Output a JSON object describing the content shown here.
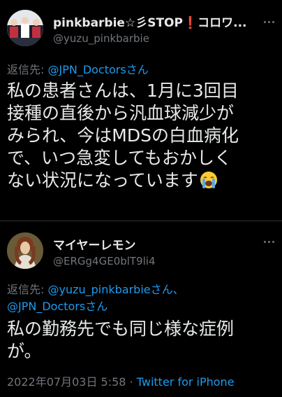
{
  "tweet1": {
    "author_name": "pinkbarbie☆彡STOP❗️コロワ...",
    "author_handle": "@yuzu_pinkbarbie",
    "reply_prefix": "返信先: ",
    "reply_mention": "@JPN_Doctors",
    "reply_suffix": "さん",
    "body_lines": [
      "私の患者さんは、1月に3回目",
      "接種の直後から汎血球減少が",
      "みられ、今はMDSの白血病化",
      "で、いつ急変してもおかしく",
      "ない状況になっています"
    ],
    "emoji_icon": "loudly-crying-face-icon"
  },
  "tweet2": {
    "author_name": "マイヤーレモン",
    "author_handle": "@ERGg4GE0blT9li4",
    "reply_prefix": "返信先: ",
    "reply_mention_1": "@yuzu_pinkbarbie",
    "reply_suffix_1": "さん、",
    "reply_mention_2": "@JPN_Doctors",
    "reply_suffix_2": "さん",
    "body_lines": [
      "私の勤務先でも同じ様な症例",
      "が。"
    ],
    "timestamp": "2022年07月03日 5:58",
    "separator": " · ",
    "source": "Twitter for iPhone"
  },
  "colors": {
    "background": "#000000",
    "text": "#e7e9ea",
    "secondary": "#71767b",
    "link": "#1d9bf0"
  }
}
